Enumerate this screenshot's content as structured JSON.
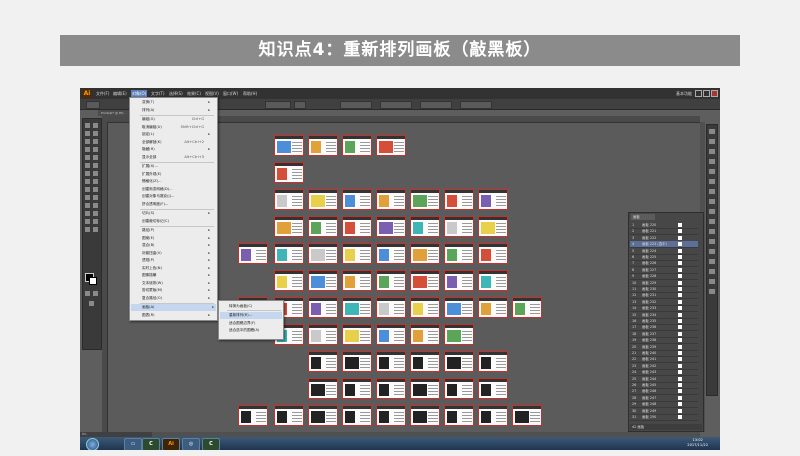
{
  "slide": {
    "title": "知识点4：重新排列画板（敲黑板）"
  },
  "app": {
    "logo": "Ai",
    "menus": [
      "文件(F)",
      "编辑(E)",
      "对象(O)",
      "文字(T)",
      "选择(S)",
      "效果(C)",
      "视图(V)",
      "窗口(W)",
      "帮助(H)"
    ],
    "active_menu": "对象(O)",
    "workspace": "基本功能",
    "doc_tab": "Printcat* @ 8%"
  },
  "object_menu": {
    "items": [
      {
        "label": "变换(T)",
        "shortcut": "",
        "arrow": true
      },
      {
        "label": "排列(A)",
        "shortcut": "",
        "arrow": true
      },
      {
        "label": "编组(G)",
        "shortcut": "Ctrl+G",
        "arrow": false
      },
      {
        "label": "取消编组(U)",
        "shortcut": "Shift+Ctrl+G",
        "arrow": false
      },
      {
        "label": "锁定(L)",
        "shortcut": "",
        "arrow": true
      },
      {
        "label": "全部解锁(K)",
        "shortcut": "Alt+Ctrl+2",
        "arrow": false
      },
      {
        "label": "隐藏(H)",
        "shortcut": "",
        "arrow": true
      },
      {
        "label": "显示全部",
        "shortcut": "Alt+Ctrl+3",
        "arrow": false
      },
      {
        "label": "扩展(X)...",
        "shortcut": "",
        "arrow": false
      },
      {
        "label": "扩展外观(E)",
        "shortcut": "",
        "arrow": false
      },
      {
        "label": "栅格化(Z)...",
        "shortcut": "",
        "arrow": false
      },
      {
        "label": "创建渐变网格(D)...",
        "shortcut": "",
        "arrow": false
      },
      {
        "label": "创建对象马赛克(J)...",
        "shortcut": "",
        "arrow": false
      },
      {
        "label": "拼合透明度(F)...",
        "shortcut": "",
        "arrow": false
      },
      {
        "label": "切片(S)",
        "shortcut": "",
        "arrow": true
      },
      {
        "label": "创建裁切标记(C)",
        "shortcut": "",
        "arrow": false
      },
      {
        "label": "路径(P)",
        "shortcut": "",
        "arrow": true
      },
      {
        "label": "图案(E)",
        "shortcut": "",
        "arrow": true
      },
      {
        "label": "混合(B)",
        "shortcut": "",
        "arrow": true
      },
      {
        "label": "封套扭曲(V)",
        "shortcut": "",
        "arrow": true
      },
      {
        "label": "透视(P)",
        "shortcut": "",
        "arrow": true
      },
      {
        "label": "实时上色(N)",
        "shortcut": "",
        "arrow": true
      },
      {
        "label": "图像描摹",
        "shortcut": "",
        "arrow": true
      },
      {
        "label": "文本绕排(W)",
        "shortcut": "",
        "arrow": true
      },
      {
        "label": "剪切蒙版(M)",
        "shortcut": "",
        "arrow": true
      },
      {
        "label": "复合路径(O)",
        "shortcut": "",
        "arrow": true
      },
      {
        "label": "画板(A)",
        "shortcut": "",
        "arrow": true
      },
      {
        "label": "图表(R)",
        "shortcut": "",
        "arrow": true
      }
    ]
  },
  "artboard_submenu": {
    "items": [
      "转换为画板(C)",
      "重新排列(R)...",
      "适合图稿边界(F)",
      "适合选中的图稿(A)"
    ]
  },
  "artboards_panel": {
    "tab": "画板",
    "rows": [
      {
        "n": "1",
        "name": "画板 220"
      },
      {
        "n": "2",
        "name": "画板 221"
      },
      {
        "n": "3",
        "name": "画板 222"
      },
      {
        "n": "4",
        "name": "画板 223 (选中)"
      },
      {
        "n": "5",
        "name": "画板 224"
      },
      {
        "n": "6",
        "name": "画板 225"
      },
      {
        "n": "7",
        "name": "画板 226"
      },
      {
        "n": "8",
        "name": "画板 227"
      },
      {
        "n": "9",
        "name": "画板 228"
      },
      {
        "n": "10",
        "name": "画板 229"
      },
      {
        "n": "11",
        "name": "画板 230"
      },
      {
        "n": "12",
        "name": "画板 231"
      },
      {
        "n": "13",
        "name": "画板 232"
      },
      {
        "n": "14",
        "name": "画板 233"
      },
      {
        "n": "15",
        "name": "画板 234"
      },
      {
        "n": "16",
        "name": "画板 235"
      },
      {
        "n": "17",
        "name": "画板 236"
      },
      {
        "n": "18",
        "name": "画板 237"
      },
      {
        "n": "19",
        "name": "画板 238"
      },
      {
        "n": "20",
        "name": "画板 239"
      },
      {
        "n": "21",
        "name": "画板 240"
      },
      {
        "n": "22",
        "name": "画板 241"
      },
      {
        "n": "23",
        "name": "画板 242"
      },
      {
        "n": "24",
        "name": "画板 243"
      },
      {
        "n": "25",
        "name": "画板 244"
      },
      {
        "n": "26",
        "name": "画板 245"
      },
      {
        "n": "27",
        "name": "画板 246"
      },
      {
        "n": "28",
        "name": "画板 247"
      },
      {
        "n": "29",
        "name": "画板 248"
      },
      {
        "n": "30",
        "name": "画板 249"
      },
      {
        "n": "31",
        "name": "画板 250"
      }
    ],
    "footer": "42 画板"
  },
  "status": {
    "zoom": "8%"
  },
  "taskbar": {
    "time": "13:02",
    "date": "2017/11/22"
  },
  "colors": {
    "accent": "#5b7fb8",
    "artboard_border": "#c8302b",
    "fill": "#000000",
    "stroke": "#ffffff"
  }
}
